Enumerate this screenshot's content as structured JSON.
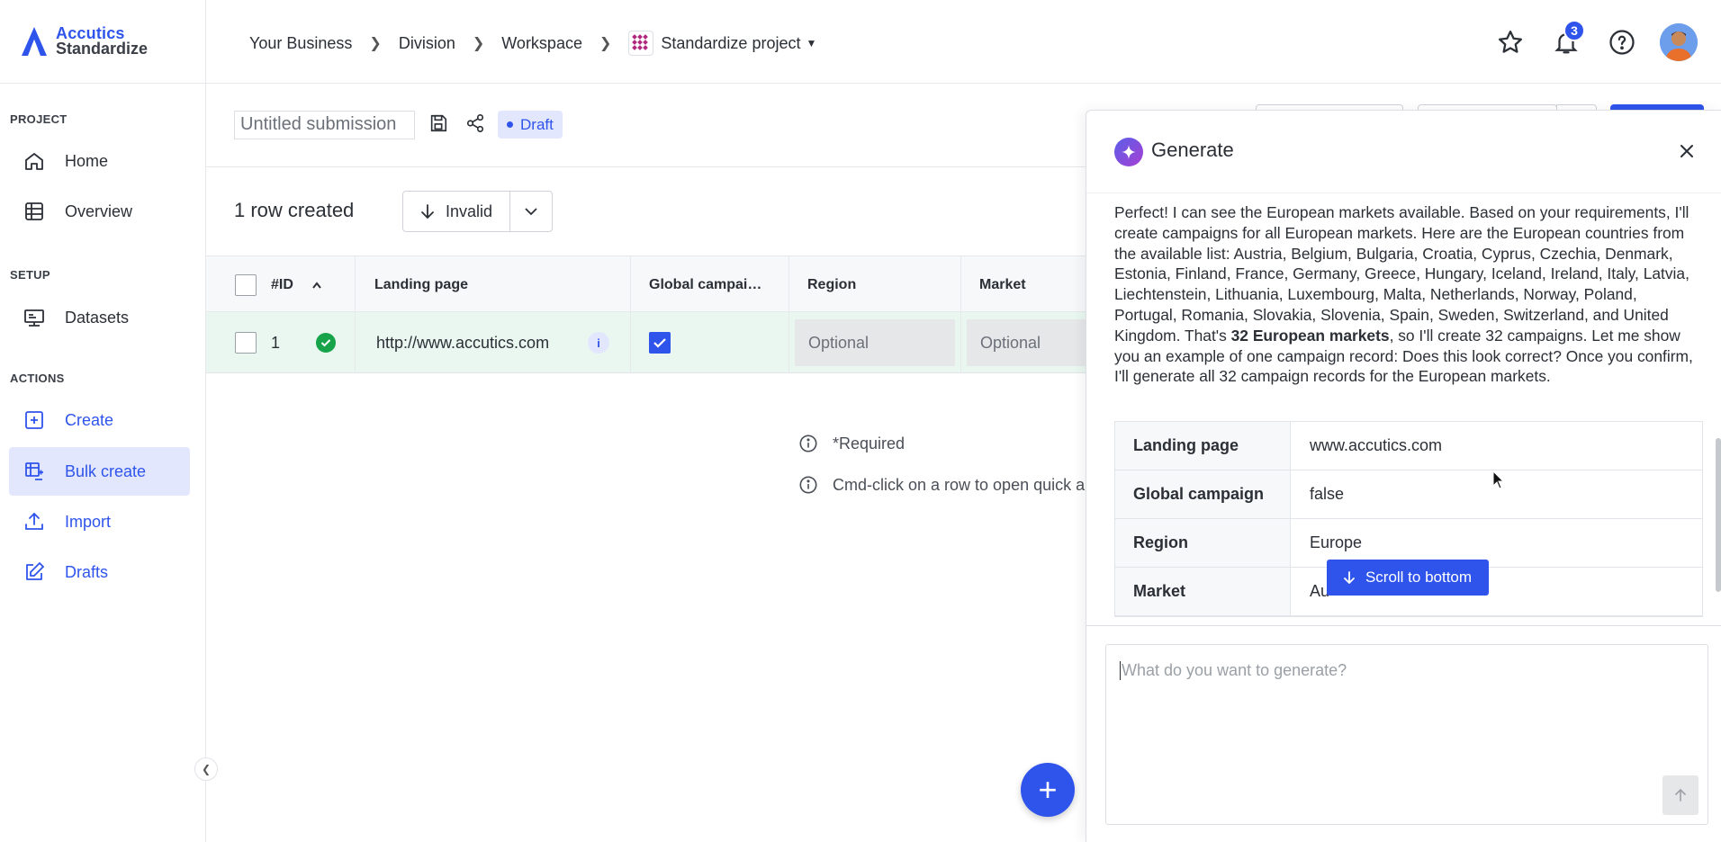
{
  "app": {
    "brand_line1": "Accutics",
    "brand_line2": "Standardize",
    "brand_color": "#2f54eb"
  },
  "breadcrumb": {
    "items": [
      "Your Business",
      "Division",
      "Workspace"
    ],
    "project": "Standardize project"
  },
  "topbar": {
    "notifications_count": "3",
    "icons": [
      "star-icon",
      "bell-icon",
      "help-icon",
      "avatar"
    ]
  },
  "sidebar": {
    "sections": {
      "project": "PROJECT",
      "setup": "SETUP",
      "actions": "ACTIONS"
    },
    "items": [
      {
        "label": "Home",
        "icon": "home-icon"
      },
      {
        "label": "Overview",
        "icon": "table-icon"
      },
      {
        "label": "Datasets",
        "icon": "dataset-icon"
      },
      {
        "label": "Create",
        "icon": "plus-square-icon"
      },
      {
        "label": "Bulk create",
        "icon": "bulk-create-icon",
        "active": true
      },
      {
        "label": "Import",
        "icon": "upload-icon"
      },
      {
        "label": "Drafts",
        "icon": "edit-icon"
      }
    ]
  },
  "submission": {
    "title_placeholder": "Untitled submission",
    "status": "Draft"
  },
  "main": {
    "rows_created": "1 row created",
    "filter_label": "Invalid"
  },
  "table": {
    "columns": [
      "#ID",
      "Landing page",
      "Global campai…",
      "Region",
      "Market"
    ],
    "rows": [
      {
        "id": "1",
        "landing_page": "http://www.accutics.com",
        "global_campaign": true,
        "region": "Optional",
        "market": "Optional"
      }
    ]
  },
  "hints": {
    "required": "*Required",
    "cmd_click": "Cmd-click on a row to open quick a"
  },
  "generate_panel": {
    "title": "Generate",
    "message_part1": "Perfect! I can see the European markets available. Based on your requirements, I'll create campaigns for all European markets. Here are the European countries from the available list: Austria, Belgium, Bulgaria, Croatia, Cyprus, Czechia, Denmark, Estonia, Finland, France, Germany, Greece, Hungary, Iceland, Ireland, Italy, Latvia, Liechtenstein, Lithuania, Luxembourg, Malta, Netherlands, Norway, Poland, Portugal, Romania, Slovakia, Slovenia, Spain, Sweden, Switzerland, and United Kingdom. That's ",
    "message_bold": "32 European markets",
    "message_part2": ", so I'll create 32 campaigns. Let me show you an example of one campaign record: Does this look correct? Once you confirm, I'll generate all 32 campaign records for the European markets.",
    "record": [
      {
        "key": "Landing page",
        "value": "www.accutics.com"
      },
      {
        "key": "Global campaign",
        "value": "false"
      },
      {
        "key": "Region",
        "value": "Europe"
      },
      {
        "key": "Market",
        "value": "Au"
      }
    ],
    "scroll_to_bottom": "Scroll to bottom",
    "input_placeholder": "What do you want to generate?"
  }
}
